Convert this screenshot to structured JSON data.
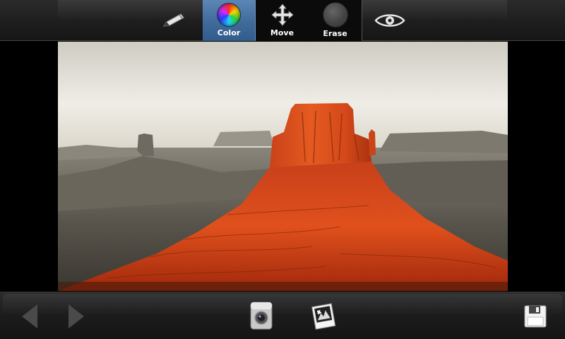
{
  "toolbar": {
    "tools": [
      {
        "id": "pencil",
        "icon": "pencil-icon"
      },
      {
        "id": "color",
        "label": "Color",
        "icon": "color-wheel-icon",
        "selected": true
      },
      {
        "id": "move",
        "label": "Move",
        "icon": "move-arrows-icon"
      },
      {
        "id": "erase",
        "label": "Erase",
        "icon": "eraser-disc-icon"
      },
      {
        "id": "preview",
        "icon": "eye-icon"
      }
    ]
  },
  "bottom": {
    "buttons": [
      {
        "id": "prev",
        "icon": "arrow-left-icon",
        "enabled": false
      },
      {
        "id": "next",
        "icon": "arrow-right-icon",
        "enabled": false
      },
      {
        "id": "camera",
        "icon": "camera-icon"
      },
      {
        "id": "gallery",
        "icon": "photo-gallery-icon"
      },
      {
        "id": "save",
        "icon": "floppy-disk-icon"
      }
    ]
  },
  "colors": {
    "selected_tab": "#4a76a8",
    "toolbar_bg": "#1f1f1f",
    "highlight_rock": "#d9531c"
  }
}
